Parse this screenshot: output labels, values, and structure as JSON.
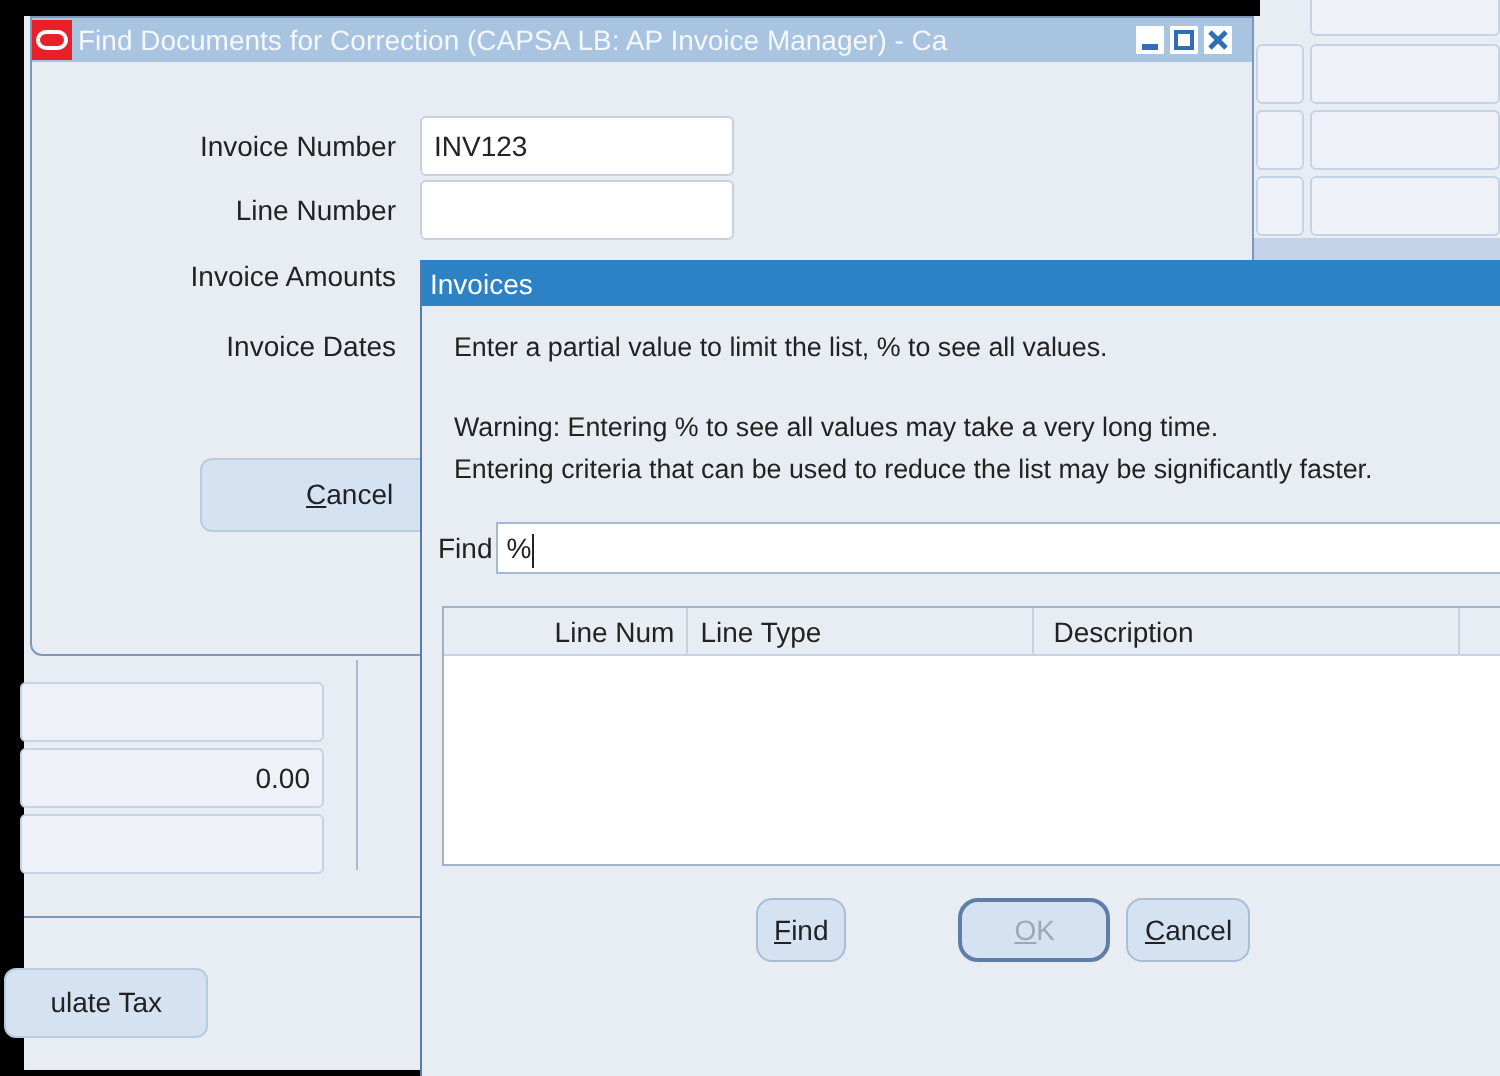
{
  "background_form": {
    "top_fields": [
      {
        "kind": "blank"
      },
      {
        "kind": "blank"
      },
      {
        "kind": "blank"
      },
      {
        "kind": "blank"
      }
    ],
    "fields": [
      {
        "kind": "blank"
      },
      {
        "kind": "amount",
        "value": "0.00"
      },
      {
        "kind": "blank"
      }
    ],
    "button": {
      "label": "ulate Tax"
    }
  },
  "find_window": {
    "title": "Find Documents for Correction (CAPSA LB: AP Invoice Manager) - Ca",
    "fields": [
      {
        "label": "Invoice Number",
        "value": "INV123",
        "kind": "input"
      },
      {
        "label": "Line Number",
        "kind": "input"
      },
      {
        "label": "Invoice Amounts"
      },
      {
        "label": "Invoice Dates"
      }
    ],
    "button": {
      "label": "Cancel"
    }
  },
  "invoices_window": {
    "title": "Invoices",
    "hint": "Enter a partial value to limit the list, % to see all values.",
    "warning": [
      "Warning: Entering % to see all values may take a very long time.",
      "Entering criteria that can be used to reduce the list may be significantly faster."
    ],
    "find": {
      "label": "Find",
      "value": "%"
    },
    "columns": [
      "Line Num",
      "Line Type",
      "Description"
    ],
    "buttons": [
      {
        "label": "Find",
        "disabled": false,
        "default": false
      },
      {
        "label": "OK",
        "disabled": true,
        "default": true
      },
      {
        "label": "Cancel",
        "disabled": false,
        "default": false
      }
    ]
  }
}
